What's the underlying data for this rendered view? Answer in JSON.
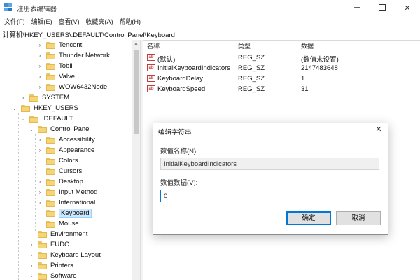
{
  "window": {
    "title": "注册表编辑器",
    "accent": "#0078d7"
  },
  "menu": [
    "文件(F)",
    "编辑(E)",
    "查看(V)",
    "收藏夹(A)",
    "帮助(H)"
  ],
  "address": "计算机\\HKEY_USERS\\.DEFAULT\\Control Panel\\Keyboard",
  "tree": [
    {
      "label": "Tencent",
      "chevron": "›"
    },
    {
      "label": "Thunder Network",
      "chevron": "›"
    },
    {
      "label": "Tobii",
      "chevron": "›"
    },
    {
      "label": "Valve",
      "chevron": "›"
    },
    {
      "label": "WOW6432Node",
      "chevron": "›"
    },
    {
      "label": "SYSTEM",
      "chevron": "›"
    },
    {
      "label": "HKEY_USERS",
      "chevron": "⌄"
    },
    {
      "label": ".DEFAULT",
      "chevron": "⌄"
    },
    {
      "label": "Control Panel",
      "chevron": "⌄"
    },
    {
      "label": "Accessibility",
      "chevron": "›"
    },
    {
      "label": "Appearance",
      "chevron": "›"
    },
    {
      "label": "Colors",
      "chevron": ""
    },
    {
      "label": "Cursors",
      "chevron": ""
    },
    {
      "label": "Desktop",
      "chevron": "›"
    },
    {
      "label": "Input Method",
      "chevron": "›"
    },
    {
      "label": "International",
      "chevron": "›"
    },
    {
      "label": "Keyboard",
      "chevron": "",
      "selected": true
    },
    {
      "label": "Mouse",
      "chevron": ""
    },
    {
      "label": "Environment",
      "chevron": ""
    },
    {
      "label": "EUDC",
      "chevron": "›"
    },
    {
      "label": "Keyboard Layout",
      "chevron": "›"
    },
    {
      "label": "Printers",
      "chevron": "›"
    },
    {
      "label": "Software",
      "chevron": "›"
    }
  ],
  "list": {
    "headers": {
      "name": "名称",
      "type": "类型",
      "data": "数据"
    },
    "rows": [
      {
        "name": "(默认)",
        "type": "REG_SZ",
        "data": "(数值未设置)"
      },
      {
        "name": "InitialKeyboardIndicators",
        "type": "REG_SZ",
        "data": "2147483648"
      },
      {
        "name": "KeyboardDelay",
        "type": "REG_SZ",
        "data": "1"
      },
      {
        "name": "KeyboardSpeed",
        "type": "REG_SZ",
        "data": "31"
      }
    ]
  },
  "dialog": {
    "title": "编辑字符串",
    "name_label": "数值名称(N):",
    "name_value": "InitialKeyboardIndicators",
    "data_label": "数值数据(V):",
    "data_value": "0",
    "ok": "确定",
    "cancel": "取消"
  }
}
